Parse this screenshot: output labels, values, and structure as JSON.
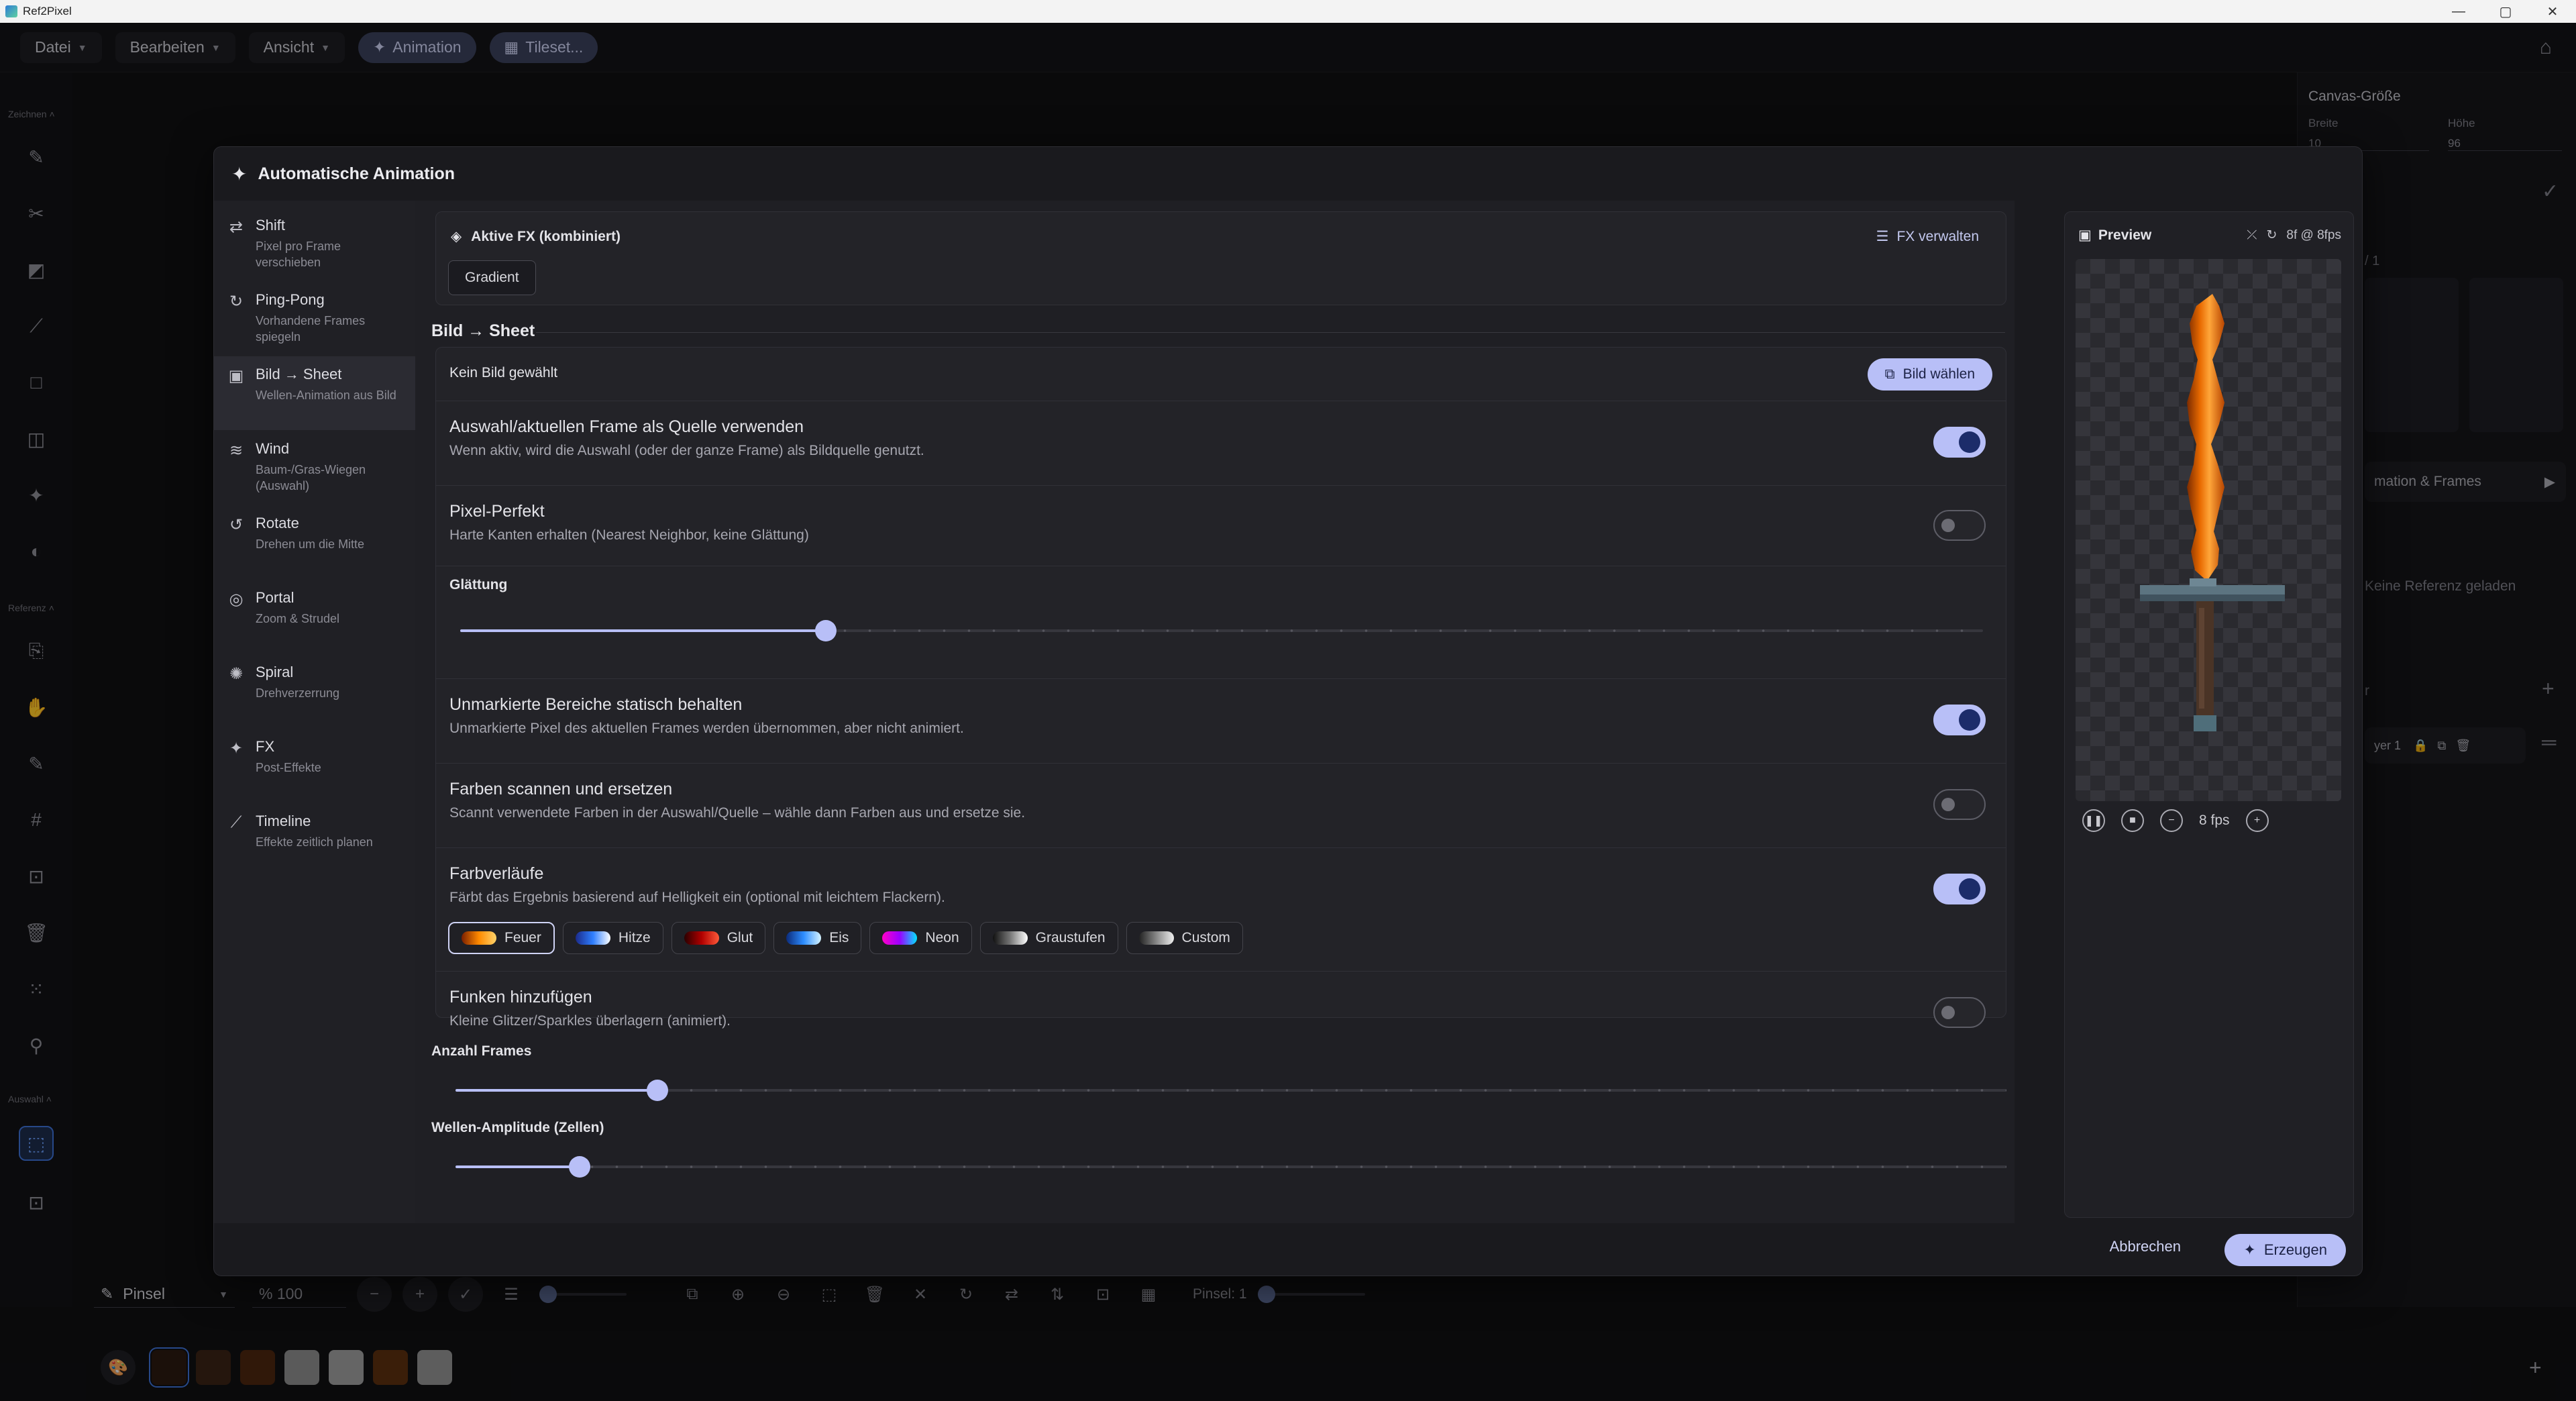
{
  "window": {
    "title": "Ref2Pixel",
    "minimize": "—",
    "maximize": "▢",
    "close": "✕"
  },
  "menu": {
    "items": [
      {
        "label": "Datei"
      },
      {
        "label": "Bearbeiten"
      },
      {
        "label": "Ansicht"
      }
    ],
    "animation": "Animation",
    "tileset": "Tileset..."
  },
  "toolstrip": {
    "zeichnen": "Zeichnen",
    "referenz": "Referenz",
    "auswahl": "Auswahl"
  },
  "right_panel": {
    "canvas_title": "Canvas-Größe",
    "width_label": "Breite",
    "height_label": "Höhe",
    "width_value": "10",
    "height_value": "96",
    "frames_count": "/ 1",
    "anim_frames": "mation & Frames",
    "no_reference": "Keine Referenz geladen",
    "layers_label": "r",
    "layer_name": "yer 1"
  },
  "bottombar": {
    "brush": "Pinsel",
    "zoom": "100",
    "brush_size_label": "Pinsel: 1"
  },
  "palette": {
    "colors": [
      "#2a1a10",
      "#3a2214",
      "#4a250f",
      "#8a8a8a",
      "#9c9c9c",
      "#5a2e0e",
      "#8f8f8f"
    ]
  },
  "modal": {
    "title": "Automatische Animation",
    "nav": [
      {
        "title": "Shift",
        "desc": "Pixel pro Frame verschieben",
        "icon": "⇄"
      },
      {
        "title": "Ping-Pong",
        "desc": "Vorhandene Frames spiegeln",
        "icon": "↻"
      },
      {
        "title": "Bild → Sheet",
        "desc": "Wellen-Animation aus Bild",
        "icon": "▣"
      },
      {
        "title": "Wind",
        "desc": "Baum-/Gras-Wiegen (Auswahl)",
        "icon": "≋"
      },
      {
        "title": "Rotate",
        "desc": "Drehen um die Mitte",
        "icon": "↺"
      },
      {
        "title": "Portal",
        "desc": "Zoom & Strudel",
        "icon": "◎"
      },
      {
        "title": "Spiral",
        "desc": "Drehverzerrung",
        "icon": "✺"
      },
      {
        "title": "FX",
        "desc": "Post-Effekte",
        "icon": "✦"
      },
      {
        "title": "Timeline",
        "desc": "Effekte zeitlich planen",
        "icon": "⟋"
      }
    ],
    "fx": {
      "title": "Aktive FX (kombiniert)",
      "manage": "FX verwalten",
      "chip": "Gradient"
    },
    "section": "Bild → Sheet",
    "no_image": "Kein Bild gewählt",
    "choose_image": "Bild wählen",
    "rows": {
      "source": {
        "title": "Auswahl/aktuellen Frame als Quelle verwenden",
        "desc": "Wenn aktiv, wird die Auswahl (oder der ganze Frame) als Bildquelle genutzt.",
        "on": true
      },
      "pixel": {
        "title": "Pixel-Perfekt",
        "desc": "Harte Kanten erhalten (Nearest Neighbor, keine Glättung)",
        "on": false
      },
      "smoothing": {
        "title": "Glättung",
        "value": 0.24
      },
      "static": {
        "title": "Unmarkierte Bereiche statisch behalten",
        "desc": "Unmarkierte Pixel des aktuellen Frames werden übernommen, aber nicht animiert.",
        "on": true
      },
      "scan": {
        "title": "Farben scannen und ersetzen",
        "desc": "Scannt verwendete Farben in der Auswahl/Quelle – wähle dann Farben aus und ersetze sie.",
        "on": false
      },
      "gradient": {
        "title": "Farbverläufe",
        "desc": "Färbt das Ergebnis basierend auf Helligkeit ein (optional mit leichtem Flackern).",
        "on": true
      },
      "sparks": {
        "title": "Funken hinzufügen",
        "desc": "Kleine Glitzer/Sparkles überlagern (animiert).",
        "on": false
      }
    },
    "gradients": [
      {
        "name": "Feuer",
        "colors": [
          "#7a1f00",
          "#ff8a00",
          "#ffd36b"
        ],
        "selected": true
      },
      {
        "name": "Hitze",
        "colors": [
          "#1b2a8a",
          "#2f7fff",
          "#ffffff"
        ],
        "selected": false
      },
      {
        "name": "Glut",
        "colors": [
          "#2a0000",
          "#b10000",
          "#ff5a3a"
        ],
        "selected": false
      },
      {
        "name": "Eis",
        "colors": [
          "#0b2a7a",
          "#2d8dff",
          "#d6f4ff"
        ],
        "selected": false
      },
      {
        "name": "Neon",
        "colors": [
          "#ff00c8",
          "#9b00ff",
          "#00e5ff"
        ],
        "selected": false
      },
      {
        "name": "Graustufen",
        "colors": [
          "#111111",
          "#777777",
          "#ffffff"
        ],
        "selected": false
      },
      {
        "name": "Custom",
        "colors": [
          "#222222",
          "#888888",
          "#eeeeee"
        ],
        "selected": false
      }
    ],
    "frames": {
      "label": "Anzahl Frames",
      "value": 0.13
    },
    "amplitude": {
      "label": "Wellen-Amplitude (Zellen)",
      "value": 0.08
    },
    "preview": {
      "title": "Preview",
      "info": "8f @ 8fps",
      "fps": "8 fps"
    },
    "cancel": "Abbrechen",
    "create": "Erzeugen"
  }
}
